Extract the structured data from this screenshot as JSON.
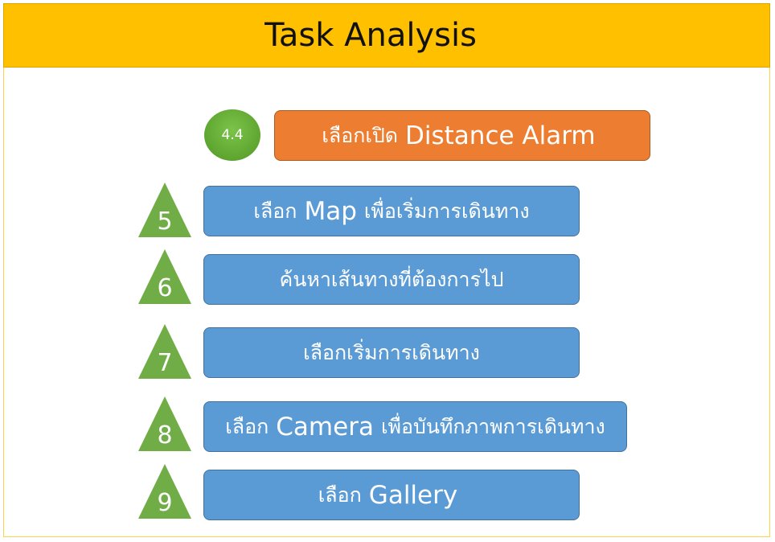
{
  "title": "Task Analysis",
  "colors": {
    "header": "#ffc000",
    "box_blue": "#5b9bd5",
    "box_orange": "#ed7d31",
    "marker_green": "#70ad47"
  },
  "step_44": {
    "number": "4.4",
    "pre": "เลือกเปิด",
    "en": "Distance Alarm"
  },
  "steps": [
    {
      "number": "5",
      "pre": "เลือก",
      "en": "Map",
      "post": "เพื่อเริ่มการเดินทาง"
    },
    {
      "number": "6",
      "text": "ค้นหาเส้นทางที่ต้องการไป"
    },
    {
      "number": "7",
      "text": "เลือกเริ่มการเดินทาง"
    },
    {
      "number": "8",
      "pre": "เลือก",
      "en": "Camera",
      "post": "เพื่อบันทึกภาพการเดินทาง"
    },
    {
      "number": "9",
      "pre": "เลือก",
      "en": "Gallery"
    }
  ]
}
